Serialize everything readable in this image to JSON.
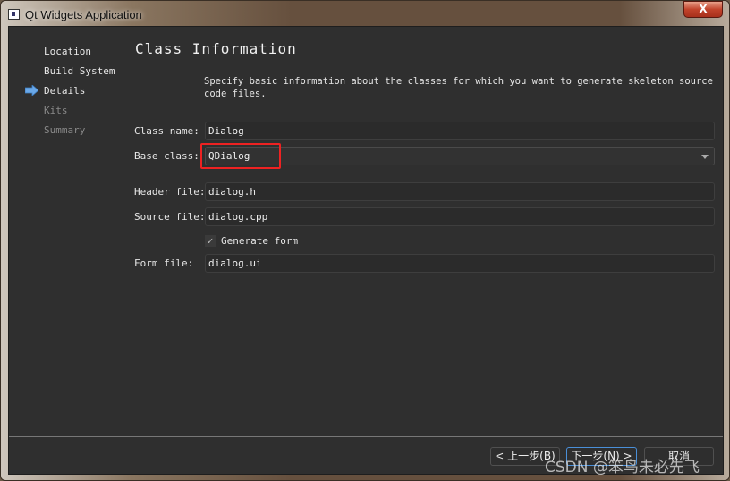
{
  "window": {
    "title": "Qt Widgets Application",
    "close_label": "X"
  },
  "sidebar": {
    "items": [
      {
        "label": "Location",
        "state": "done"
      },
      {
        "label": "Build System",
        "state": "done"
      },
      {
        "label": "Details",
        "state": "current"
      },
      {
        "label": "Kits",
        "state": "pending"
      },
      {
        "label": "Summary",
        "state": "pending"
      }
    ],
    "current_icon": "arrow-right-icon"
  },
  "page": {
    "title": "Class Information",
    "description": "Specify basic information about the classes for which you want to generate skeleton source code files.",
    "class_name": {
      "label": "Class name:",
      "value": "Dialog"
    },
    "base_class": {
      "label": "Base class:",
      "value": "QDialog",
      "highlight_color": "#ee2222"
    },
    "header_file": {
      "label": "Header file:",
      "value": "dialog.h"
    },
    "source_file": {
      "label": "Source file:",
      "value": "dialog.cpp"
    },
    "generate_form": {
      "label": "Generate form",
      "checked": true
    },
    "form_file": {
      "label": "Form file:",
      "value": "dialog.ui"
    }
  },
  "buttons": {
    "back": "< 上一步(B)",
    "next": "下一步(N) >",
    "cancel": "取消"
  },
  "watermark": "CSDN @笨鸟未必先飞"
}
